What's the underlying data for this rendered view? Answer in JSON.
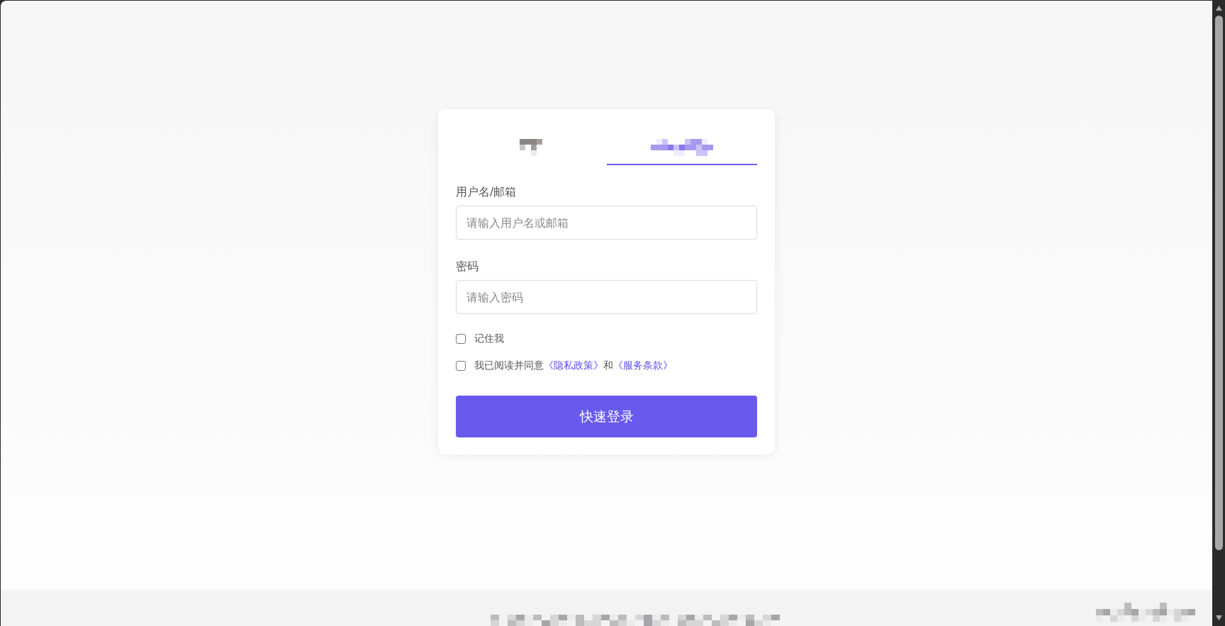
{
  "tabs": [
    {
      "selected": false
    },
    {
      "selected": true
    }
  ],
  "fields": [
    {
      "label": "用户名/邮箱",
      "placeholder": "请输入用户名或邮箱"
    },
    {
      "label": "密码",
      "placeholder": "请输入密码"
    }
  ],
  "options": [
    {
      "checked": false,
      "parts": [
        {
          "kind": "text",
          "text": "记住我"
        }
      ]
    },
    {
      "checked": false,
      "parts": [
        {
          "kind": "text",
          "text": "我已阅读并同意"
        },
        {
          "kind": "link",
          "text": "《隐私政策》"
        },
        {
          "kind": "text",
          "text": "和"
        },
        {
          "kind": "link",
          "text": "《服务条款》"
        }
      ]
    }
  ],
  "submit_button": {
    "label": "快速登录"
  }
}
